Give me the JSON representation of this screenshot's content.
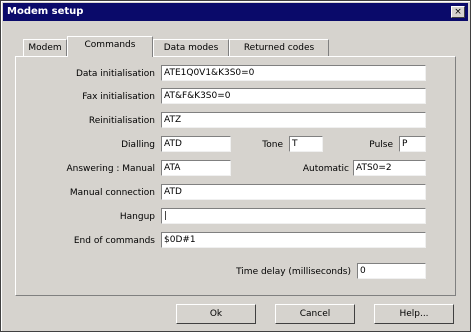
{
  "window": {
    "title": "Modem setup",
    "close_glyph": "×"
  },
  "tabs": [
    {
      "label": "Modem"
    },
    {
      "label": "Commands"
    },
    {
      "label": "Data modes"
    },
    {
      "label": "Returned codes"
    }
  ],
  "fields": {
    "data_initialisation": {
      "label": "Data initialisation",
      "value": "ATE1Q0V1&K3S0=0"
    },
    "fax_initialisation": {
      "label": "Fax initialisation",
      "value": "AT&F&K3S0=0"
    },
    "reinitialisation": {
      "label": "Reinitialisation",
      "value": "ATZ"
    },
    "dialling": {
      "label": "Dialling",
      "value": "ATD"
    },
    "tone": {
      "label": "Tone",
      "value": "T"
    },
    "pulse": {
      "label": "Pulse",
      "value": "P"
    },
    "answering_manual": {
      "label": "Answering : Manual",
      "value": "ATA"
    },
    "automatic": {
      "label": "Automatic",
      "value": "ATS0=2"
    },
    "manual_connection": {
      "label": "Manual connection",
      "value": "ATD"
    },
    "hangup": {
      "label": "Hangup",
      "value": "|"
    },
    "end_of_commands": {
      "label": "End of commands",
      "value": "$0D#1"
    },
    "time_delay": {
      "label": "Time delay (milliseconds)",
      "value": "0"
    }
  },
  "buttons": {
    "ok": "Ok",
    "cancel": "Cancel",
    "help": "Help..."
  }
}
